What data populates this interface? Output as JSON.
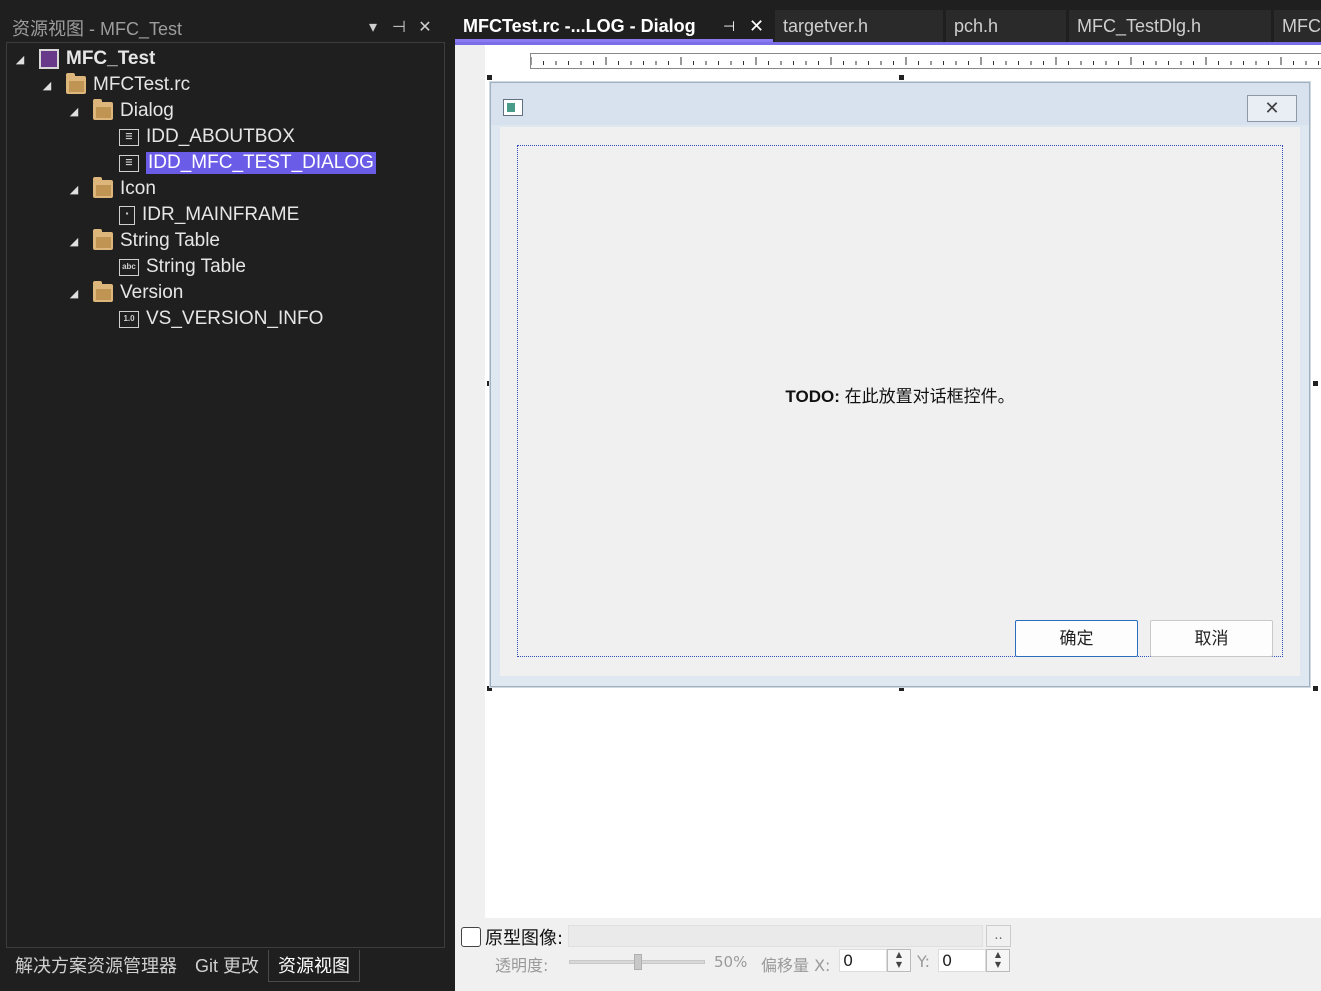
{
  "left_panel": {
    "title": "资源视图 - MFC_Test",
    "controls": [
      "▾",
      "⊣",
      "✕"
    ],
    "tree": [
      {
        "label": "MFC_Test",
        "icon": "project-icon",
        "level": 0,
        "arrow": "◢",
        "bold": true
      },
      {
        "label": "MFCTest.rc",
        "icon": "folder-icon",
        "level": 1,
        "arrow": "◢"
      },
      {
        "label": "Dialog",
        "icon": "folder-icon",
        "level": 2,
        "arrow": "◢"
      },
      {
        "label": "IDD_ABOUTBOX",
        "icon": "dialog-resource-icon",
        "level": 3
      },
      {
        "label": "IDD_MFC_TEST_DIALOG",
        "icon": "dialog-resource-icon",
        "level": 3,
        "selected": true
      },
      {
        "label": "Icon",
        "icon": "folder-icon",
        "level": 2,
        "arrow": "◢"
      },
      {
        "label": "IDR_MAINFRAME",
        "icon": "icon-resource-icon",
        "level": 3
      },
      {
        "label": "String Table",
        "icon": "folder-icon",
        "level": 2,
        "arrow": "◢"
      },
      {
        "label": "String Table",
        "icon": "string-table-icon",
        "level": 3,
        "badge": "abc"
      },
      {
        "label": "Version",
        "icon": "folder-icon",
        "level": 2,
        "arrow": "◢"
      },
      {
        "label": "VS_VERSION_INFO",
        "icon": "version-resource-icon",
        "level": 3,
        "badge": "1.0"
      }
    ],
    "bottom_tabs": [
      "解决方案资源管理器",
      "Git 更改",
      "资源视图"
    ],
    "active_bottom_tab": 2
  },
  "editor": {
    "tabs": [
      "MFCTest.rc -...LOG - Dialog",
      "targetver.h",
      "pch.h",
      "MFC_TestDlg.h",
      "MFC"
    ],
    "active_tab": 0,
    "tab_pin": "⊣",
    "tab_close": "✕",
    "dialog": {
      "close_glyph": "✕",
      "todo_prefix": "TODO:",
      "todo_text": " 在此放置对话框控件。",
      "ok_label": "确定",
      "cancel_label": "取消"
    },
    "prototype": {
      "label": "原型图像:",
      "browse": "..",
      "opacity_label": "透明度:",
      "opacity_value": "50%",
      "opacity": 0.5,
      "offset_x_label": "偏移量 X:",
      "offset_x": "0",
      "offset_y_label": "Y:",
      "offset_y": "0"
    }
  },
  "colors": {
    "selection": "#6b5ce7",
    "accent": "#7a6ee8",
    "folder": "#dcb67a"
  }
}
